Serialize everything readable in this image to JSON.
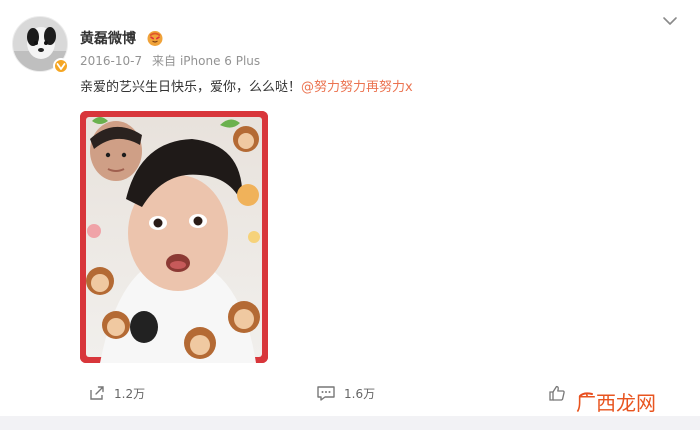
{
  "post": {
    "author": "黄磊微博",
    "date": "2016-10-7",
    "source_prefix": "来自",
    "source_device": "iPhone 6 Plus",
    "text": "亲爱的艺兴生日快乐，爱你，么么哒！",
    "mention": "@努力努力再努力x"
  },
  "actions": {
    "forward_count": "1.2万",
    "comment_count": "1.6万"
  },
  "watermark": {
    "text": "广西龙网"
  },
  "icons": {
    "verify_badge": "verify-badge-icon",
    "vip": "vip-face-icon",
    "menu": "chevron-down-icon",
    "forward": "share-icon",
    "comment": "comment-icon",
    "like": "thumbs-up-icon"
  },
  "colors": {
    "mention": "#eb7350",
    "meta_text": "#939393",
    "badge": "#f5a623",
    "photo_frame": "#d8363b"
  }
}
